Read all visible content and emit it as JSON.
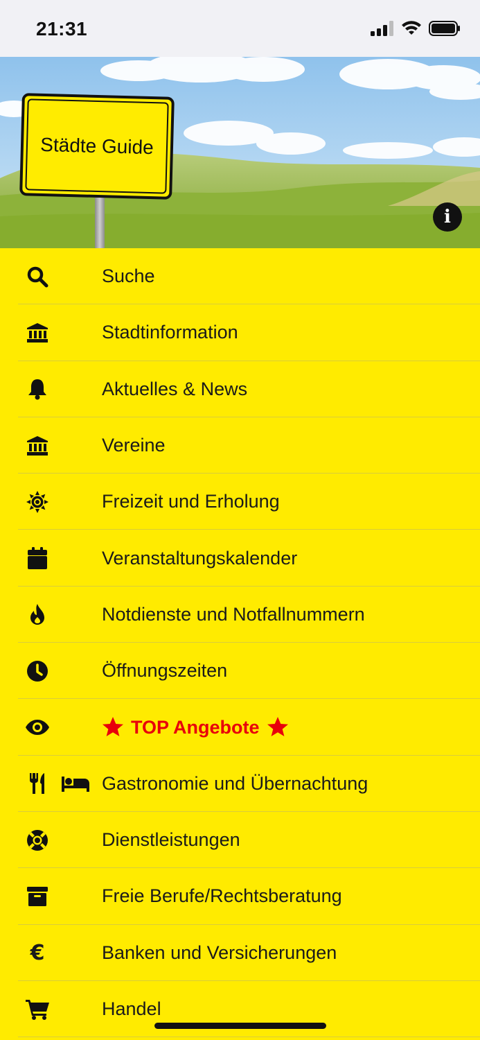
{
  "status_bar": {
    "time": "21:31"
  },
  "header": {
    "sign_text": "Städte Guide"
  },
  "menu": {
    "items": [
      {
        "label": "Suche",
        "icon": "search-icon"
      },
      {
        "label": "Stadtinformation",
        "icon": "bank-icon"
      },
      {
        "label": "Aktuelles & News",
        "icon": "bell-icon"
      },
      {
        "label": "Vereine",
        "icon": "bank-icon"
      },
      {
        "label": "Freizeit und Erholung",
        "icon": "sun-icon"
      },
      {
        "label": "Veranstaltungskalender",
        "icon": "calendar-icon"
      },
      {
        "label": "Notdienste und Notfallnummern",
        "icon": "fire-icon"
      },
      {
        "label": "Öffnungszeiten",
        "icon": "clock-icon"
      },
      {
        "label": "TOP Angebote",
        "icon": "eye-icon"
      },
      {
        "label": "Gastronomie und Übernachtung",
        "icon": "utensils-icon"
      },
      {
        "label": "Dienstleistungen",
        "icon": "lifebuoy-icon"
      },
      {
        "label": "Freie Berufe/Rechtsberatung",
        "icon": "archive-icon"
      },
      {
        "label": "Banken und Versicherungen",
        "icon": "euro-icon"
      },
      {
        "label": "Handel",
        "icon": "cart-icon"
      }
    ]
  },
  "colors": {
    "background": "#FFEB00",
    "highlight": "#E8000B"
  }
}
